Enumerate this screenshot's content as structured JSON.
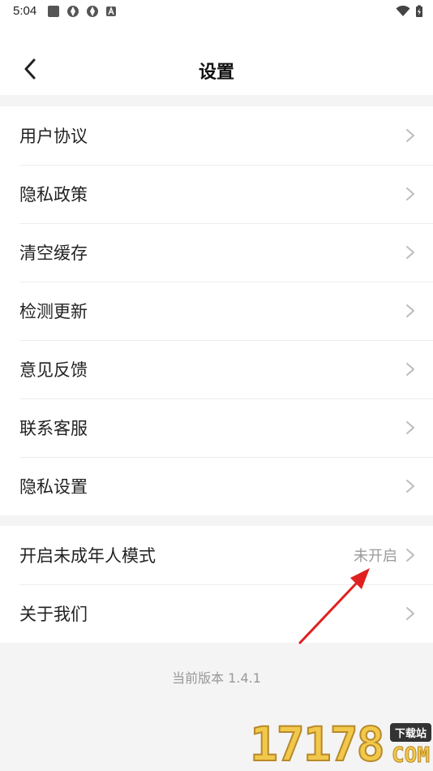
{
  "status_bar": {
    "time": "5:04",
    "left_icons": [
      "app-square-icon",
      "aperture-icon",
      "aperture-icon",
      "a-notification-icon"
    ],
    "right_icons": [
      "wifi-icon",
      "battery-charging-icon"
    ]
  },
  "header": {
    "back_icon": "chevron-left-icon",
    "title": "设置"
  },
  "menu_group_1": [
    {
      "label": "用户协议"
    },
    {
      "label": "隐私政策"
    },
    {
      "label": "清空缓存"
    },
    {
      "label": "检测更新"
    },
    {
      "label": "意见反馈"
    },
    {
      "label": "联系客服"
    },
    {
      "label": "隐私设置"
    }
  ],
  "menu_group_2": [
    {
      "label": "开启未成年人模式",
      "value": "未开启"
    },
    {
      "label": "关于我们"
    }
  ],
  "footer": {
    "version": "当前版本 1.4.1"
  },
  "watermark": {
    "digits": "17178",
    "badge": "下载站",
    "domain": "COM"
  },
  "colors": {
    "page_background": "#f4f4f4",
    "card_background": "#ffffff",
    "divider": "#ececec",
    "muted_text": "#999999",
    "annotation_arrow": "#e02020"
  }
}
